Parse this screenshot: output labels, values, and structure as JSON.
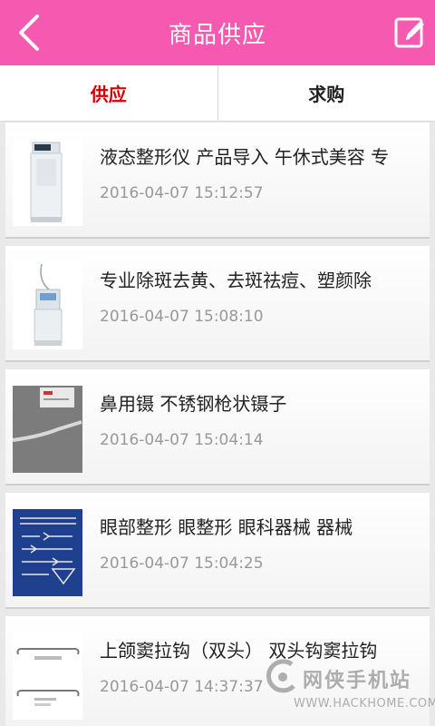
{
  "header": {
    "title": "商品供应",
    "back_icon": "chevron-left-icon",
    "edit_icon": "edit-icon",
    "bg_color": "#f55ab0"
  },
  "tabs": [
    {
      "label": "供应",
      "active": true
    },
    {
      "label": "求购",
      "active": false
    }
  ],
  "accent_color": "#d40000",
  "items": [
    {
      "title": "液态整形仪 产品导入 午休式美容 专",
      "time": "2016-04-07 15:12:57"
    },
    {
      "title": "专业除斑去黄、去斑祛痘、塑颜除",
      "time": "2016-04-07 15:08:10"
    },
    {
      "title": "鼻用镊 不锈钢枪状镊子",
      "time": "2016-04-07 15:04:14"
    },
    {
      "title": "眼部整形 眼整形 眼科器械 器械",
      "time": "2016-04-07 15:04:25"
    },
    {
      "title": "上颌窦拉钩（双头） 双头钩窦拉钩",
      "time": "2016-04-07 14:37:37"
    }
  ],
  "watermark": {
    "name": "网侠手机站",
    "url": "WWW.HACKHOME.COM"
  }
}
